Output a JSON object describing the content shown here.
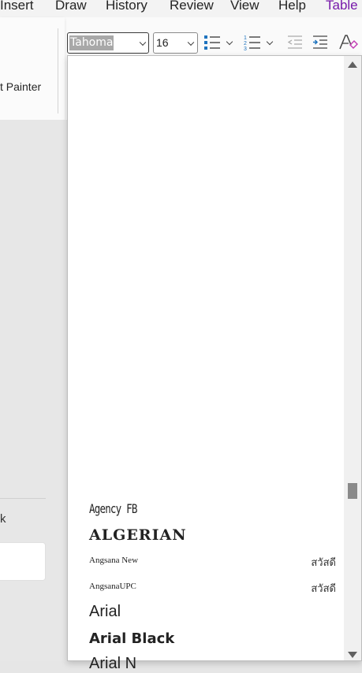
{
  "menubar": {
    "items": [
      {
        "label": "Insert"
      },
      {
        "label": "Draw"
      },
      {
        "label": "History"
      },
      {
        "label": "Review"
      },
      {
        "label": "View"
      },
      {
        "label": "Help"
      },
      {
        "label": "Table"
      }
    ]
  },
  "ribbon": {
    "format_painter_label": "t Painter",
    "font_name_value": "Tahoma",
    "font_size_value": "16"
  },
  "left_panel": {
    "letter": "k"
  },
  "font_list": {
    "items": [
      {
        "label": "Agency FB"
      },
      {
        "label": "ALGERIAN"
      },
      {
        "label": "Angsana New",
        "sample": "สวัสดี"
      },
      {
        "label": "AngsanaUPC",
        "sample": "สวัสดี"
      },
      {
        "label": "Arial"
      },
      {
        "label": "Arial Black"
      },
      {
        "label": "Arial N"
      }
    ]
  },
  "colors": {
    "accent": "#7719aa",
    "icon_blue": "#1e73be"
  }
}
